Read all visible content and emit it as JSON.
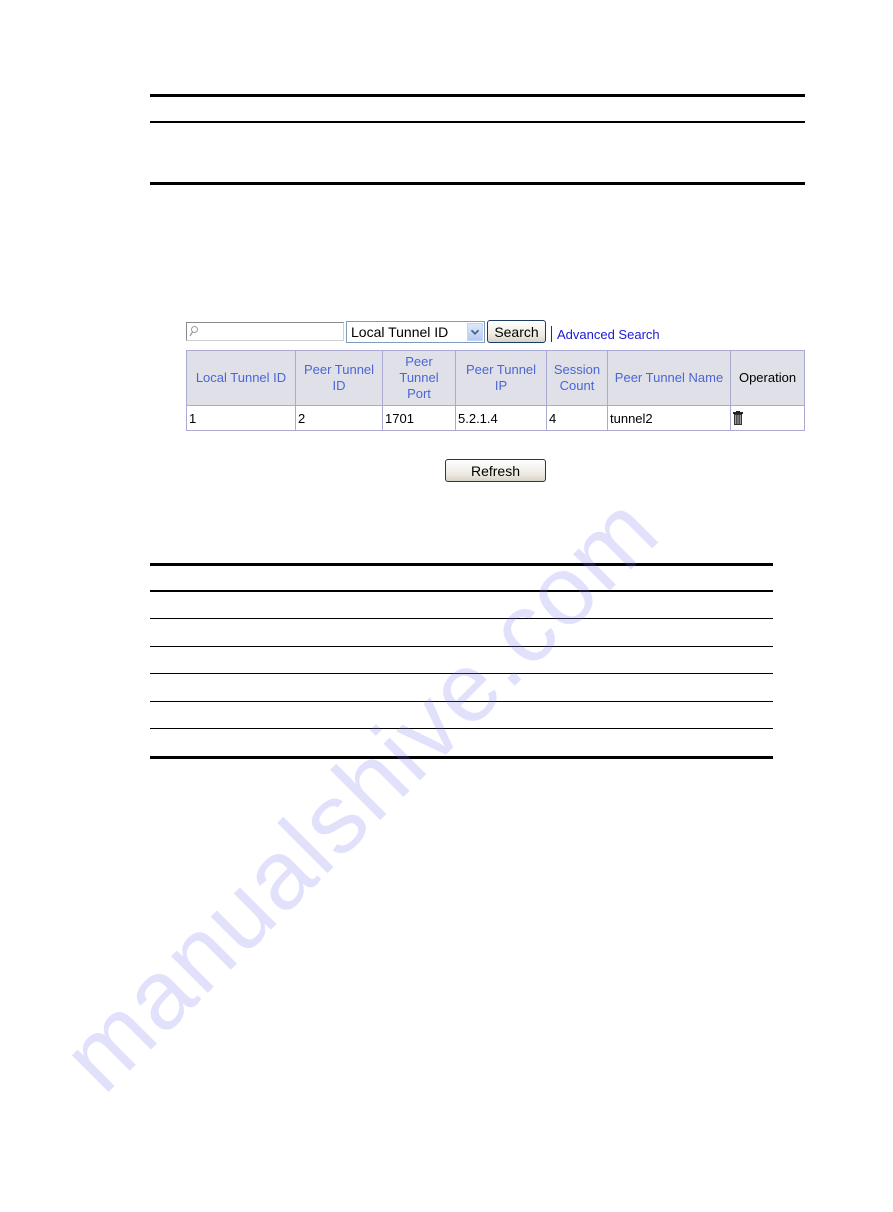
{
  "search": {
    "input_value": "",
    "field_select": {
      "selected": "Local Tunnel ID"
    },
    "search_label": "Search",
    "advanced_label": "Advanced Search"
  },
  "tunnel_table": {
    "headers": [
      "Local Tunnel ID",
      "Peer Tunnel ID",
      "Peer Tunnel Port",
      "Peer Tunnel IP",
      "Session Count",
      "Peer Tunnel Name",
      "Operation"
    ],
    "rows": [
      {
        "local_tunnel_id": "1",
        "peer_tunnel_id": "2",
        "peer_tunnel_port": "1701",
        "peer_tunnel_ip": "5.2.1.4",
        "session_count": "4",
        "peer_tunnel_name": "tunnel2",
        "operation_icon": "trash-icon"
      }
    ]
  },
  "refresh_label": "Refresh",
  "colors": {
    "header_text": "#4a66d6",
    "header_bg": "#e0e0e8",
    "link": "#1b1bd1",
    "border": "#aaaad2"
  },
  "watermark": "manualshive.com"
}
